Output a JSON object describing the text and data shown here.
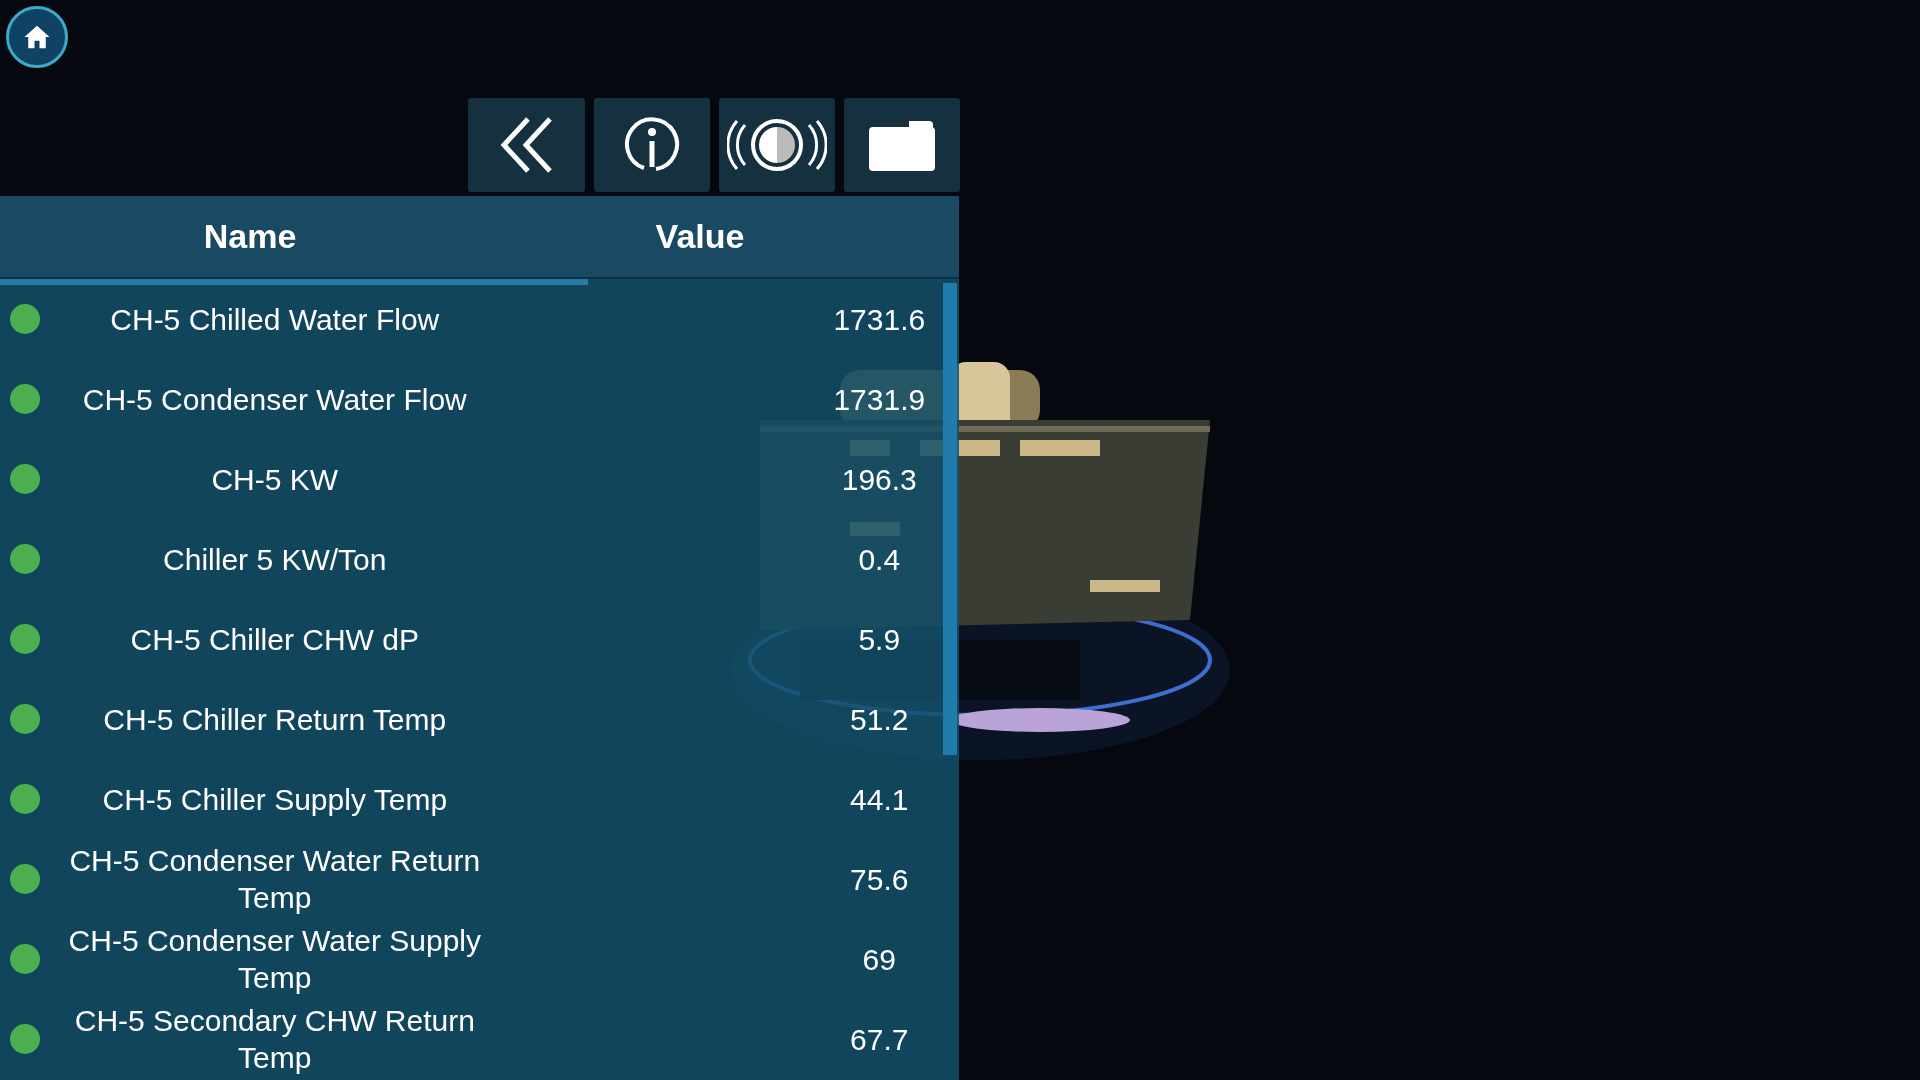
{
  "table": {
    "columns": [
      "Name",
      "Value"
    ],
    "rows": [
      {
        "name": "CH-5 Chilled Water Flow",
        "value": "1731.6",
        "color": "#4caf50"
      },
      {
        "name": "CH-5 Condenser Water Flow",
        "value": "1731.9",
        "color": "#4caf50"
      },
      {
        "name": "CH-5 KW",
        "value": "196.3",
        "color": "#4caf50"
      },
      {
        "name": "Chiller 5 KW/Ton",
        "value": "0.4",
        "color": "#4caf50"
      },
      {
        "name": "CH-5 Chiller CHW dP",
        "value": "5.9",
        "color": "#4caf50"
      },
      {
        "name": "CH-5 Chiller Return Temp",
        "value": "51.2",
        "color": "#4caf50"
      },
      {
        "name": "CH-5 Chiller Supply Temp",
        "value": "44.1",
        "color": "#4caf50"
      },
      {
        "name": "CH-5 Condenser Water Return Temp",
        "value": "75.6",
        "color": "#4caf50"
      },
      {
        "name": "CH-5 Condenser Water Supply Temp",
        "value": "69",
        "color": "#4caf50"
      },
      {
        "name": "CH-5 Secondary CHW Return Temp",
        "value": "67.7",
        "color": "#4caf50"
      }
    ]
  }
}
